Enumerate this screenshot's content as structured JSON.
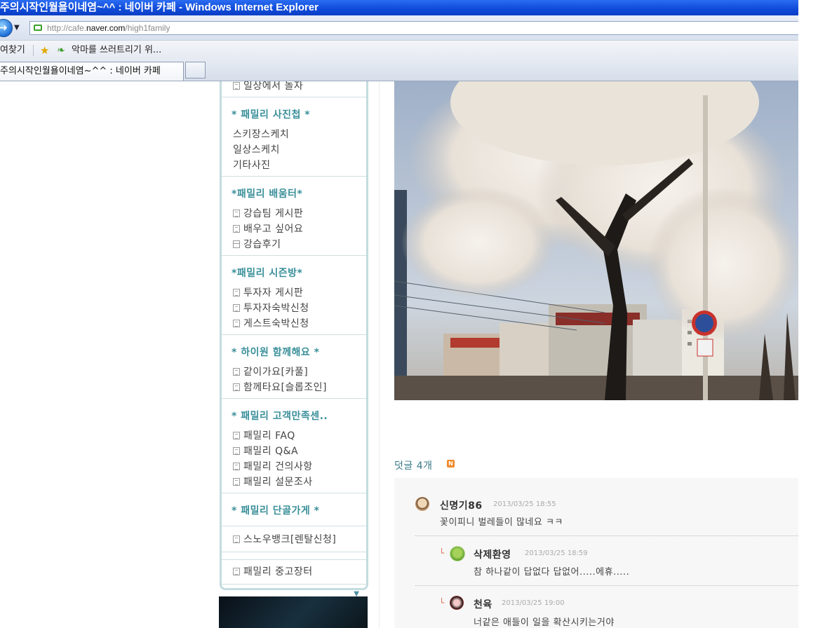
{
  "window": {
    "title": "주의시작인월욜이네염~^^ : 네이버 카페 - Windows Internet Explorer"
  },
  "address": {
    "prefix": "http://cafe.",
    "domain": "naver.com",
    "path": "/high1family"
  },
  "favorites": {
    "label": "여찾기",
    "link": "악마를 쓰러트리기 위..."
  },
  "tabs": {
    "active": "주의시작인월욜이네염~^^ : 네이버 카페"
  },
  "sidebar": {
    "top_item": "일상에서 놀자",
    "sections": [
      {
        "title": "* 패밀리 사진첩 *",
        "items": [
          {
            "label": "스키장스케치",
            "icon": "photo"
          },
          {
            "label": "일상스케치",
            "icon": "photo"
          },
          {
            "label": "기타사진",
            "icon": "photo"
          }
        ]
      },
      {
        "title": "*패밀리 배움터*",
        "items": [
          {
            "label": "강습팀 게시판",
            "icon": "board"
          },
          {
            "label": "배우고 싶어요",
            "icon": "board"
          },
          {
            "label": "강습후기",
            "icon": "review"
          }
        ]
      },
      {
        "title": "*패밀리 시즌방*",
        "items": [
          {
            "label": "투자자 게시판",
            "icon": "board"
          },
          {
            "label": "투자자숙박신청",
            "icon": "board"
          },
          {
            "label": "게스트숙박신청",
            "icon": "board"
          }
        ]
      },
      {
        "title": "* 하이원 함께해요 *",
        "items": [
          {
            "label": "같이가요[카풀]",
            "icon": "board"
          },
          {
            "label": "함께타요[슬롭조인]",
            "icon": "board"
          }
        ]
      },
      {
        "title": "* 패밀리 고객만족센..",
        "items": [
          {
            "label": "패밀리 FAQ",
            "icon": "board"
          },
          {
            "label": "패밀리 Q&A",
            "icon": "board"
          },
          {
            "label": "패밀리 건의사항",
            "icon": "board"
          },
          {
            "label": "패밀리 설문조사",
            "icon": "board"
          }
        ]
      },
      {
        "title": "* 패밀리 단골가게 *",
        "items": []
      }
    ],
    "extra_items": [
      "스노우뱅크[렌탈신청]",
      "패밀리 중고장터"
    ],
    "dropdown_value": "."
  },
  "comments": {
    "title": "덧글",
    "count": "4개",
    "new_badge": "N",
    "list": [
      {
        "name": "신명기86",
        "date": "2013/03/25 18:55",
        "text": "꽃이피니 벌레들이 많네요 ㅋㅋ",
        "reply": false
      },
      {
        "name": "삭제환영",
        "date": "2013/03/25 18:59",
        "text": "참 하나같이 답없다 답없어.....에휴.....",
        "reply": true
      },
      {
        "name": "천육",
        "date": "2013/03/25 19:00",
        "text": "너같은 애들이 일을 확산시키는거야",
        "reply": true
      }
    ]
  },
  "colors": {
    "accent": "#3a8f9a",
    "titlebar": "#0f4ad8"
  }
}
